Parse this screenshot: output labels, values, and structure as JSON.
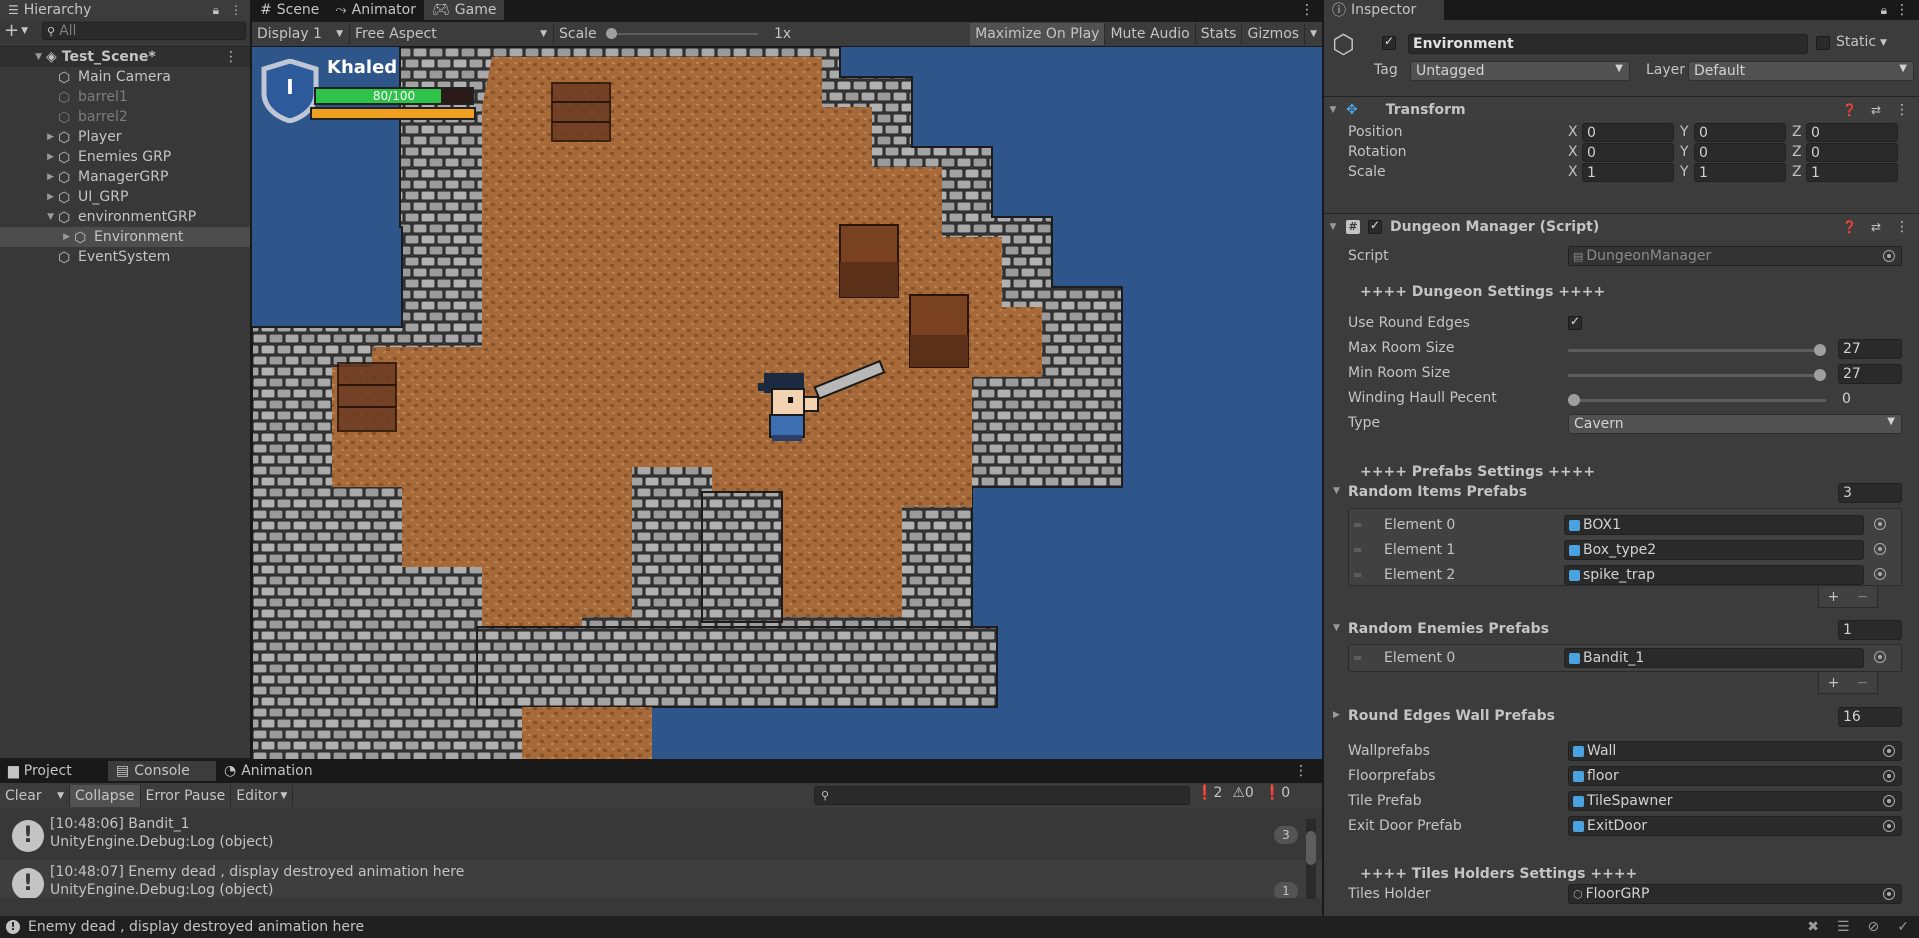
{
  "hierarchy": {
    "tab": "Hierarchy",
    "search_placeholder": "All",
    "scene": "Test_Scene*",
    "items": [
      {
        "label": "Main Camera",
        "indent": 1,
        "fold": "",
        "dim": false,
        "selected": false
      },
      {
        "label": "barrel1",
        "indent": 1,
        "fold": "",
        "dim": true,
        "selected": false
      },
      {
        "label": "barrel2",
        "indent": 1,
        "fold": "",
        "dim": true,
        "selected": false
      },
      {
        "label": "Player",
        "indent": 1,
        "fold": "▶",
        "dim": false,
        "selected": false
      },
      {
        "label": "Enemies GRP",
        "indent": 1,
        "fold": "▶",
        "dim": false,
        "selected": false
      },
      {
        "label": "ManagerGRP",
        "indent": 1,
        "fold": "▶",
        "dim": false,
        "selected": false
      },
      {
        "label": "UI_GRP",
        "indent": 1,
        "fold": "▶",
        "dim": false,
        "selected": false
      },
      {
        "label": "environmentGRP",
        "indent": 1,
        "fold": "▼",
        "dim": false,
        "selected": false
      },
      {
        "label": "Environment",
        "indent": 2,
        "fold": "▶",
        "dim": false,
        "selected": true
      },
      {
        "label": "EventSystem",
        "indent": 1,
        "fold": "",
        "dim": false,
        "selected": false
      }
    ]
  },
  "center_tabs": [
    "Scene",
    "Animator",
    "Game"
  ],
  "game_toolbar": {
    "display": "Display 1",
    "aspect": "Free Aspect",
    "scale_label": "Scale",
    "scale_value": "1x",
    "buttons": [
      "Maximize On Play",
      "Mute Audio",
      "Stats",
      "Gizmos"
    ]
  },
  "hud": {
    "player_name": "Khaled",
    "health_text": "80/100",
    "health_fraction": 0.8,
    "level": "I",
    "health_color": "#2ec24a",
    "xp_color": "#f0a020"
  },
  "bottom": {
    "tabs": [
      "Project",
      "Console",
      "Animation"
    ],
    "toolbar": [
      "Clear",
      "Collapse",
      "Error Pause",
      "Editor"
    ],
    "counts": {
      "errors": "2",
      "warnings": "0",
      "info": "0"
    },
    "logs": [
      {
        "line1": "[10:48:06] Bandit_1",
        "line2": "UnityEngine.Debug:Log (object)",
        "count": "3"
      },
      {
        "line1": "[10:48:07] Enemy dead , display destroyed animation here",
        "line2": "UnityEngine.Debug:Log (object)",
        "count": "1"
      }
    ]
  },
  "status_bar": "Enemy dead , display destroyed animation here",
  "inspector": {
    "tab": "Inspector",
    "object_name": "Environment",
    "static_label": "Static",
    "tag_label": "Tag",
    "tag_value": "Untagged",
    "layer_label": "Layer",
    "layer_value": "Default",
    "transform": {
      "title": "Transform",
      "rows": [
        {
          "label": "Position",
          "x": "0",
          "y": "0",
          "z": "0"
        },
        {
          "label": "Rotation",
          "x": "0",
          "y": "0",
          "z": "0"
        },
        {
          "label": "Scale",
          "x": "1",
          "y": "1",
          "z": "1"
        }
      ]
    },
    "script": {
      "title": "Dungeon Manager (Script)",
      "script_label": "Script",
      "script_value": "DungeonManager",
      "dungeon_header": "++++ Dungeon Settings ++++",
      "round_edges_label": "Use Round Edges",
      "max_room_label": "Max Room Size",
      "max_room_value": "27",
      "max_room_fraction": 1.0,
      "min_room_label": "Min Room Size",
      "min_room_value": "27",
      "min_room_fraction": 1.0,
      "winding_label": "Winding Haull Pecent",
      "winding_value": "0",
      "winding_fraction": 0.0,
      "type_label": "Type",
      "type_value": "Cavern",
      "prefabs_header": "++++ Prefabs Settings ++++",
      "random_items_label": "Random Items Prefabs",
      "random_items_count": "3",
      "random_items": [
        {
          "label": "Element 0",
          "value": "BOX1"
        },
        {
          "label": "Element 1",
          "value": "Box_type2"
        },
        {
          "label": "Element 2",
          "value": "spike_trap"
        }
      ],
      "random_enemies_label": "Random Enemies Prefabs",
      "random_enemies_count": "1",
      "random_enemies": [
        {
          "label": "Element 0",
          "value": "Bandit_1"
        }
      ],
      "round_walls_label": "Round Edges Wall Prefabs",
      "round_walls_count": "16",
      "refs": [
        {
          "label": "Wallprefabs",
          "value": "Wall"
        },
        {
          "label": "Floorprefabs",
          "value": "floor"
        },
        {
          "label": "Tile Prefab",
          "value": "TileSpawner"
        },
        {
          "label": "Exit Door Prefab",
          "value": "ExitDoor"
        }
      ],
      "tiles_header": "++++ Tiles Holders Settings ++++",
      "tiles_holder_label": "Tiles Holder",
      "tiles_holder_value": "FloorGRP"
    }
  }
}
